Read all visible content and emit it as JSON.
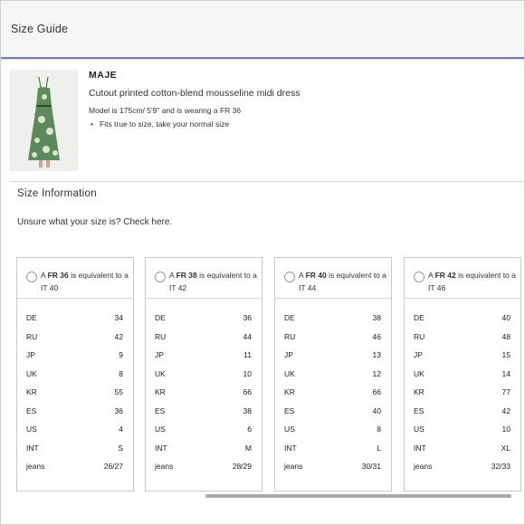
{
  "header": {
    "title": "Size Guide"
  },
  "product": {
    "brand": "MAJE",
    "name": "Cutout printed cotton-blend mousseline midi dress",
    "model_info": "Model is 175cm/ 5'9\" and is wearing a FR 36",
    "fit_note": "Fits true to size, take your normal size"
  },
  "size_info": {
    "title": "Size Information",
    "unsure_text": "Unsure what your size is? Check here."
  },
  "cards": [
    {
      "prefix": "A ",
      "size": "FR 36",
      "suffix": " is equivalent to a IT 40",
      "rows": [
        [
          "DE",
          "34"
        ],
        [
          "RU",
          "42"
        ],
        [
          "JP",
          "9"
        ],
        [
          "UK",
          "8"
        ],
        [
          "KR",
          "55"
        ],
        [
          "ES",
          "36"
        ],
        [
          "US",
          "4"
        ],
        [
          "INT",
          "S"
        ],
        [
          "jeans",
          "26/27"
        ]
      ]
    },
    {
      "prefix": "A ",
      "size": "FR 38",
      "suffix": " is equivalent to a IT 42",
      "rows": [
        [
          "DE",
          "36"
        ],
        [
          "RU",
          "44"
        ],
        [
          "JP",
          "11"
        ],
        [
          "UK",
          "10"
        ],
        [
          "KR",
          "66"
        ],
        [
          "ES",
          "38"
        ],
        [
          "US",
          "6"
        ],
        [
          "INT",
          "M"
        ],
        [
          "jeans",
          "28/29"
        ]
      ]
    },
    {
      "prefix": "A ",
      "size": "FR 40",
      "suffix": " is equivalent to a IT 44",
      "rows": [
        [
          "DE",
          "38"
        ],
        [
          "RU",
          "46"
        ],
        [
          "JP",
          "13"
        ],
        [
          "UK",
          "12"
        ],
        [
          "KR",
          "66"
        ],
        [
          "ES",
          "40"
        ],
        [
          "US",
          "8"
        ],
        [
          "INT",
          "L"
        ],
        [
          "jeans",
          "30/31"
        ]
      ]
    },
    {
      "prefix": "A ",
      "size": "FR 42",
      "suffix": " is equivalent to a IT 46",
      "rows": [
        [
          "DE",
          "40"
        ],
        [
          "RU",
          "48"
        ],
        [
          "JP",
          "15"
        ],
        [
          "UK",
          "14"
        ],
        [
          "KR",
          "77"
        ],
        [
          "ES",
          "42"
        ],
        [
          "US",
          "10"
        ],
        [
          "INT",
          "XL"
        ],
        [
          "jeans",
          "32/33"
        ]
      ]
    }
  ]
}
